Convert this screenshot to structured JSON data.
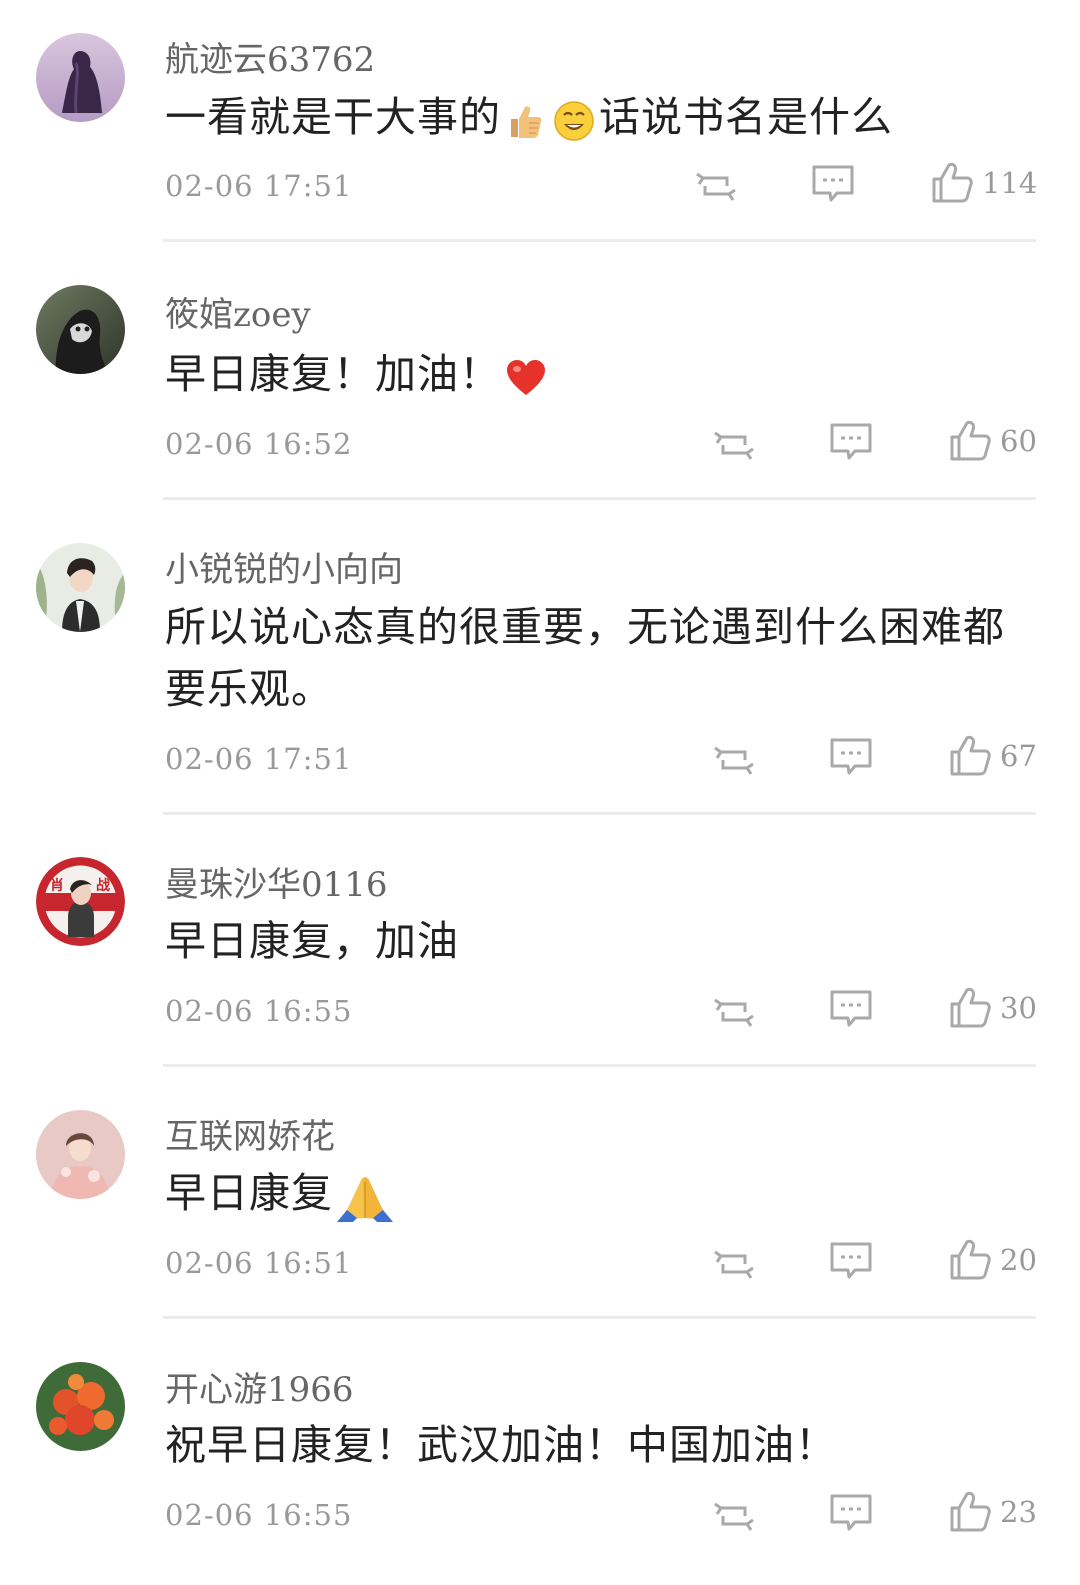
{
  "comments": [
    {
      "username": "航迹云63762",
      "text_parts": [
        "一看就是干大事的",
        "",
        "话说书名是什么"
      ],
      "emojis": [
        "thumbs-up-emoji",
        "grinning-face-emoji"
      ],
      "time": "02-06 17:51",
      "likes": "114"
    },
    {
      "username": "筱婠zoey",
      "text_parts": [
        "早日康复！加油！"
      ],
      "emojis": [
        "red-heart-emoji"
      ],
      "time": "02-06 16:52",
      "likes": "60"
    },
    {
      "username": "小锐锐的小向向",
      "text_parts": [
        "所以说心态真的很重要，无论遇到什么困难都要乐观。"
      ],
      "emojis": [],
      "time": "02-06 17:51",
      "likes": "67"
    },
    {
      "username": "曼珠沙华0116",
      "text_parts": [
        "早日康复，加油"
      ],
      "emojis": [],
      "time": "02-06 16:55",
      "likes": "30"
    },
    {
      "username": "互联网娇花",
      "text_parts": [
        "早日康复"
      ],
      "emojis": [
        "folded-hands-emoji"
      ],
      "time": "02-06 16:51",
      "likes": "20"
    },
    {
      "username": "开心游1966",
      "text_parts": [
        "祝早日康复！武汉加油！中国加油！"
      ],
      "emojis": [],
      "time": "02-06 16:55",
      "likes": "23"
    }
  ],
  "avatar4_text": [
    "肖",
    "战"
  ],
  "icons": {
    "repost": "repost-icon",
    "comment": "comment-icon",
    "like": "like-icon"
  },
  "colors": {
    "text": "#222222",
    "meta": "#999999",
    "username": "#666666",
    "divider": "#ececec"
  }
}
